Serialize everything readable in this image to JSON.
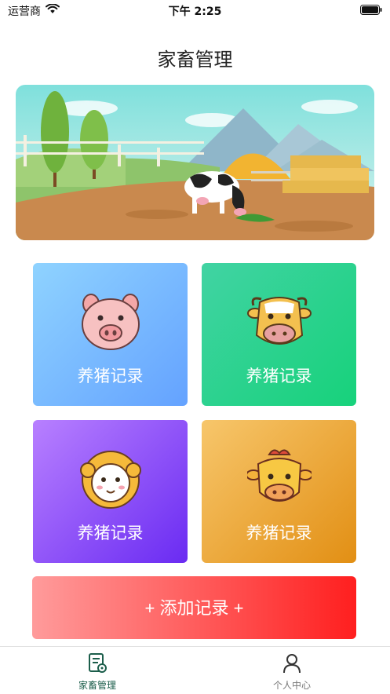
{
  "status_bar": {
    "carrier": "运营商",
    "time": "下午 2:25"
  },
  "header": {
    "title": "家畜管理"
  },
  "cards": [
    {
      "label": "养猪记录",
      "icon": "pig-icon"
    },
    {
      "label": "养猪记录",
      "icon": "cow-icon"
    },
    {
      "label": "养猪记录",
      "icon": "sheep-icon"
    },
    {
      "label": "养猪记录",
      "icon": "chicken-icon"
    }
  ],
  "add_button": {
    "label": "+ 添加记录 +"
  },
  "tabs": [
    {
      "label": "家畜管理",
      "icon": "document-settings-icon",
      "active": true
    },
    {
      "label": "个人中心",
      "icon": "user-icon",
      "active": false
    }
  ],
  "colors": {
    "active_tab": "#1c5e4b",
    "inactive_tab": "#777777",
    "add_button_start": "#ff9b9b",
    "add_button_end": "#ff1f1f"
  }
}
